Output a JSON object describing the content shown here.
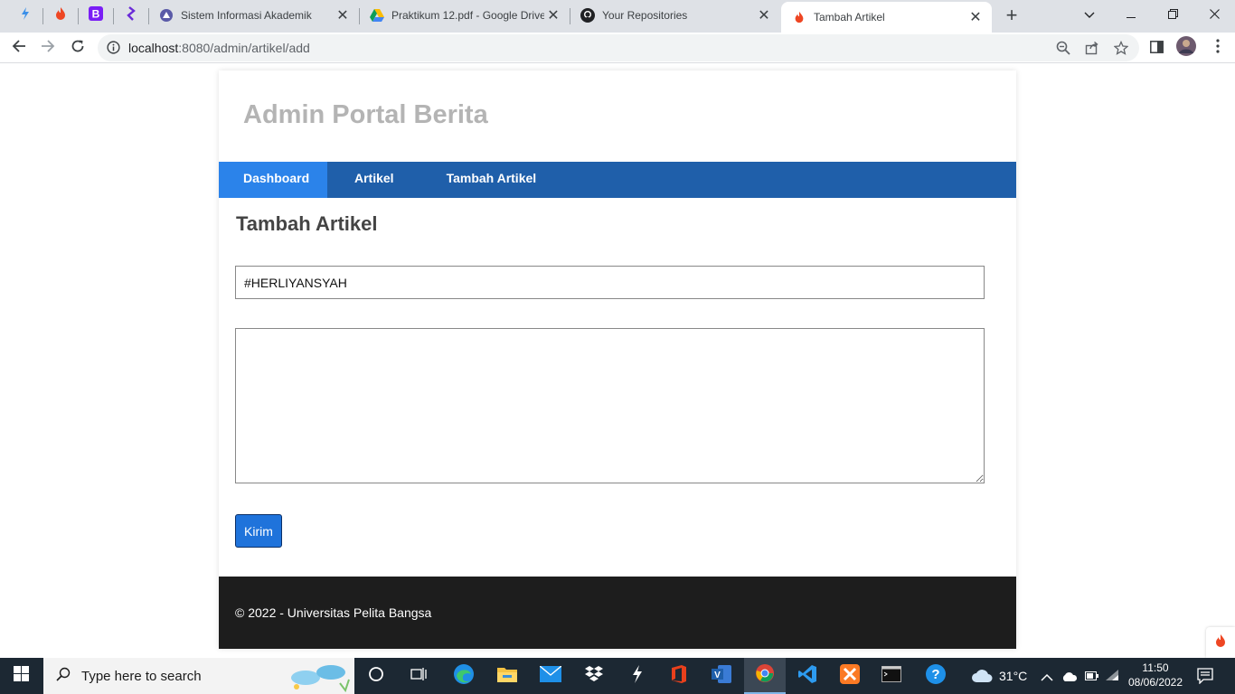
{
  "browser": {
    "tabs": [
      {
        "title": "Sistem Informasi Akademik"
      },
      {
        "title": "Praktikum 12.pdf - Google Drive"
      },
      {
        "title": "Your Repositories"
      },
      {
        "title": "Tambah Artikel"
      }
    ],
    "url_host": "localhost",
    "url_path": ":8080/admin/artikel/add"
  },
  "site": {
    "title": "Admin Portal Berita",
    "nav": [
      "Dashboard",
      "Artikel",
      "Tambah Artikel"
    ]
  },
  "form": {
    "heading": "Tambah Artikel",
    "judul_value": "#HERLIYANSYAH",
    "isi_value": "",
    "submit_label": "Kirim"
  },
  "footer": {
    "text": "© 2022 - Universitas Pelita Bangsa"
  },
  "taskbar": {
    "search_placeholder": "Type here to search",
    "weather": "31°C",
    "time": "11:50",
    "date": "08/06/2022"
  },
  "colors": {
    "nav_bg": "#1f5faa",
    "nav_active": "#2b83ea",
    "footer_bg": "#1d1d1d",
    "button": "#1f73db"
  }
}
